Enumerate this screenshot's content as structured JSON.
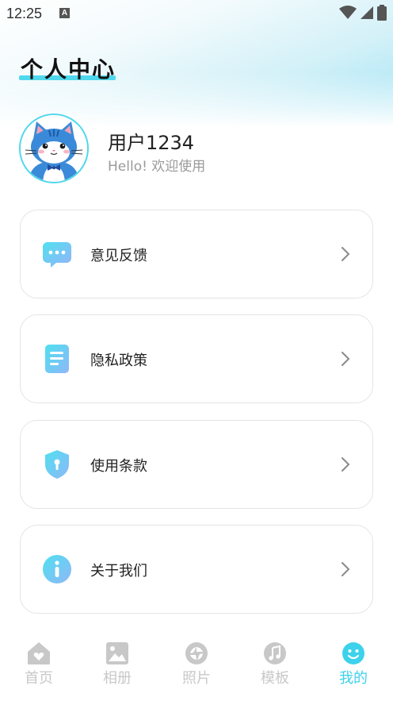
{
  "status_bar": {
    "time": "12:25",
    "notification_letter": "A"
  },
  "page": {
    "title": "个人中心"
  },
  "profile": {
    "name": "用户1234",
    "greeting": "Hello! 欢迎使用"
  },
  "menu": [
    {
      "label": "意见反馈",
      "icon": "chat-bubble-icon"
    },
    {
      "label": "隐私政策",
      "icon": "document-icon"
    },
    {
      "label": "使用条款",
      "icon": "shield-icon"
    },
    {
      "label": "关于我们",
      "icon": "info-icon"
    }
  ],
  "tabbar": {
    "tabs": [
      {
        "label": "首页",
        "icon": "home-icon",
        "active": false
      },
      {
        "label": "相册",
        "icon": "image-icon",
        "active": false
      },
      {
        "label": "照片",
        "icon": "photo-aperture-icon",
        "active": false
      },
      {
        "label": "模板",
        "icon": "music-note-icon",
        "active": false
      },
      {
        "label": "我的",
        "icon": "smiley-icon",
        "active": true
      }
    ]
  },
  "colors": {
    "accent": "#3dd2ec",
    "inactive": "#c8c8c8",
    "card_border": "#e4e4e4"
  }
}
